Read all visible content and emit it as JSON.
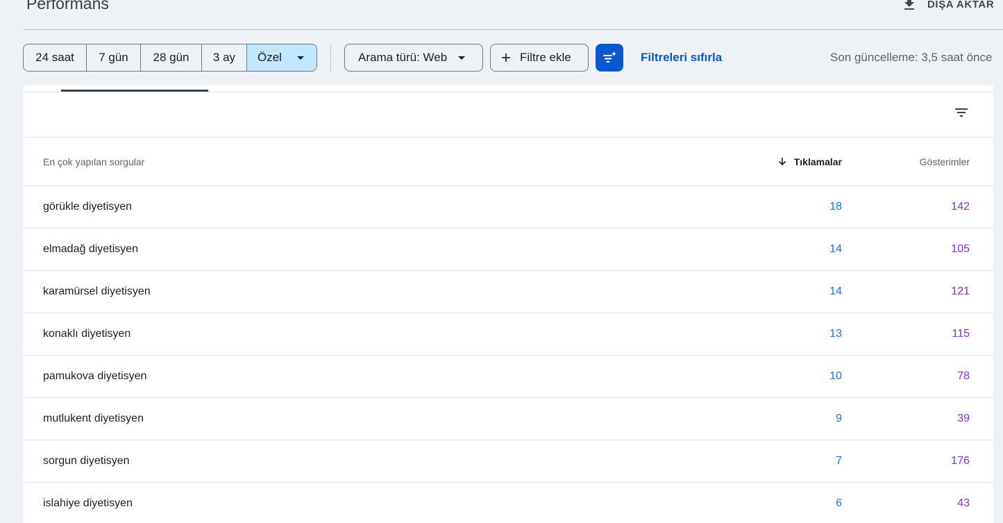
{
  "header": {
    "title": "Performans",
    "export_label": "DIŞA AKTAR"
  },
  "toolbar": {
    "date_ranges": [
      "24 saat",
      "7 gün",
      "28 gün",
      "3 ay",
      "Özel"
    ],
    "selected_range": "Özel",
    "search_type_label": "Arama türü: Web",
    "add_filter_label": "Filtre ekle",
    "reset_filters_label": "Filtreleri sıfırla",
    "last_update": "Son güncelleme: 3,5 saat önce"
  },
  "table": {
    "columns": {
      "query": "En çok yapılan sorgular",
      "clicks": "Tıklamalar",
      "impressions": "Gösterimler"
    },
    "sort_column": "clicks",
    "sort_direction": "descending",
    "rows": [
      {
        "query": "görükle diyetisyen",
        "clicks": "18",
        "impressions": "142"
      },
      {
        "query": "elmadağ diyetisyen",
        "clicks": "14",
        "impressions": "105"
      },
      {
        "query": "karamürsel diyetisyen",
        "clicks": "14",
        "impressions": "121"
      },
      {
        "query": "konaklı diyetisyen",
        "clicks": "13",
        "impressions": "115"
      },
      {
        "query": "pamukova diyetisyen",
        "clicks": "10",
        "impressions": "78"
      },
      {
        "query": "mutlukent diyetisyen",
        "clicks": "9",
        "impressions": "39"
      },
      {
        "query": "sorgun diyetisyen",
        "clicks": "7",
        "impressions": "176"
      },
      {
        "query": "islahiye diyetisyen",
        "clicks": "6",
        "impressions": "43"
      }
    ]
  },
  "colors": {
    "accent": "#0b57d0",
    "selected_chip": "#c2e7ff",
    "clicks": "#1a73e8",
    "impressions": "#8430ce",
    "background": "#eef1f6"
  },
  "icons": {
    "export": "download-icon",
    "add_filter": "plus-icon",
    "magic_filter": "filter-sparkle-icon",
    "table_filter": "filter-lines-icon",
    "sort": "arrow-down-icon",
    "dropdown": "caret-down-icon"
  }
}
